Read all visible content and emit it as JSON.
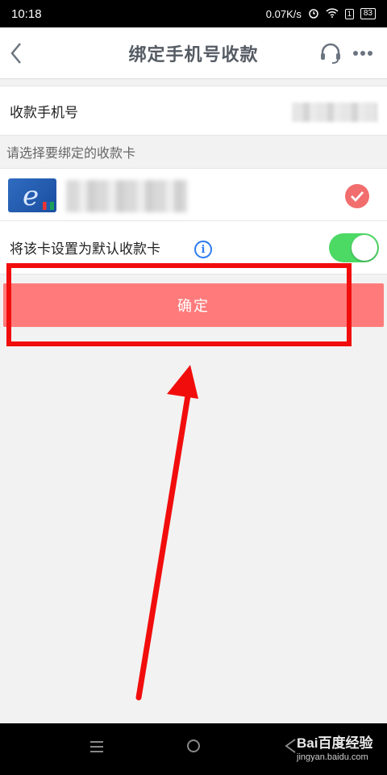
{
  "status_bar": {
    "time": "10:18",
    "network_speed": "0.07K/s",
    "sim": "1",
    "battery": "83"
  },
  "header": {
    "title": "绑定手机号收款",
    "back_icon": "chevron-left-icon",
    "support_icon": "headset-icon",
    "more_icon": "more-dots-icon"
  },
  "phone_row": {
    "label": "收款手机号"
  },
  "card_section": {
    "hint": "请选择要绑定的收款卡"
  },
  "default_row": {
    "label": "将该卡设置为默认收款卡",
    "info_glyph": "i",
    "toggle_on": true
  },
  "confirm_button": {
    "label": "确定"
  },
  "watermark": {
    "logo": "Bai百度经验",
    "url": "jingyan.baidu.com"
  },
  "colors": {
    "button": "#ff7b7b",
    "annotation": "#f20d0d",
    "toggle": "#4cd964",
    "check": "#f26d6d"
  }
}
